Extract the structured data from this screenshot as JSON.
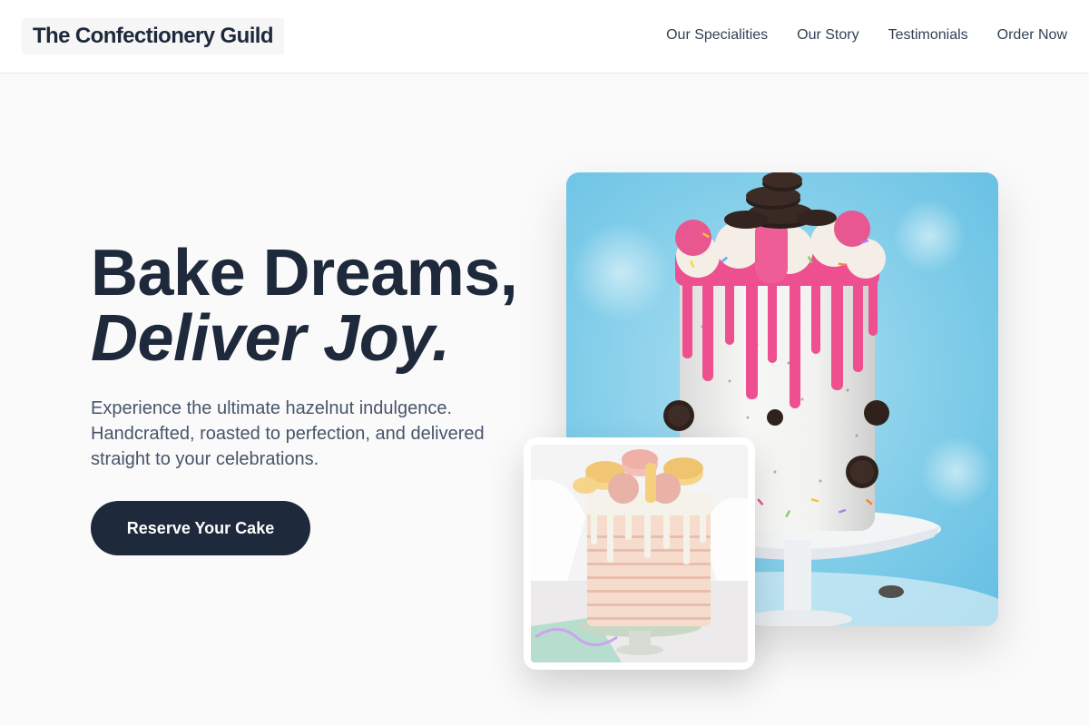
{
  "header": {
    "brand": "The Confectionery Guild",
    "nav": [
      "Our Specialities",
      "Our Story",
      "Testimonials",
      "Order Now"
    ]
  },
  "hero": {
    "title_line1": "Bake Dreams,",
    "title_line2": "Deliver Joy.",
    "subtitle": "Experience the ultimate hazelnut indulgence. Handcrafted, roasted to perfection, and delivered straight to your celebrations.",
    "cta_label": "Reserve Your Cake"
  },
  "images": {
    "main": "oreo-drip-cake-photo",
    "secondary": "macaron-pastel-cake-photo"
  },
  "colors": {
    "primary": "#1e293b",
    "body_text": "#475569",
    "nav_text": "#334155",
    "page_bg": "#fafafa",
    "header_bg": "#ffffff"
  }
}
